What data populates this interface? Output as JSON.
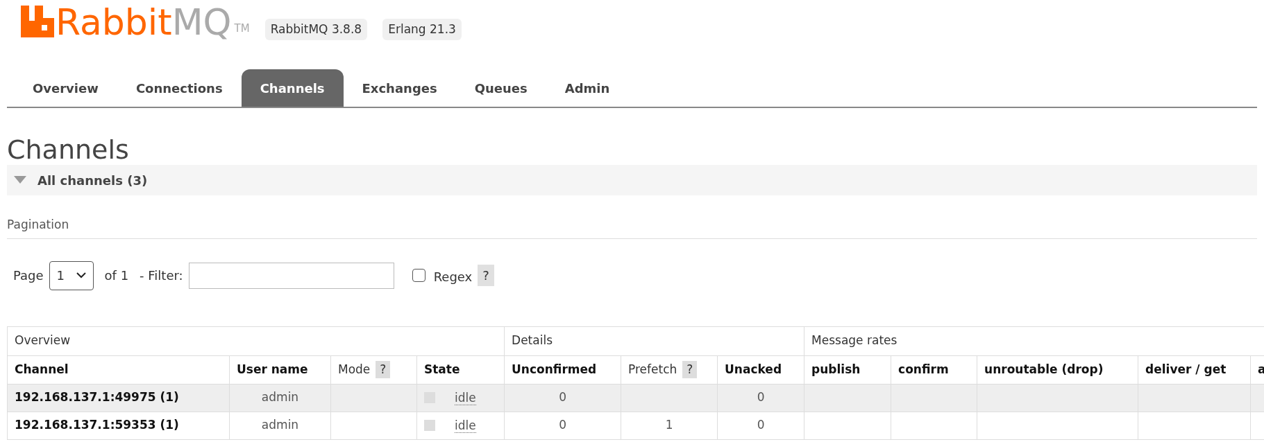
{
  "logo": {
    "brand_part": "Rabbit",
    "product_part": "MQ",
    "trademark": "TM"
  },
  "versions": [
    "RabbitMQ 3.8.8",
    "Erlang 21.3"
  ],
  "tabs": [
    {
      "label": "Overview",
      "selected": false
    },
    {
      "label": "Connections",
      "selected": false
    },
    {
      "label": "Channels",
      "selected": true
    },
    {
      "label": "Exchanges",
      "selected": false
    },
    {
      "label": "Queues",
      "selected": false
    },
    {
      "label": "Admin",
      "selected": false
    }
  ],
  "page_title": "Channels",
  "section": {
    "title": "All channels (3)",
    "expanded": true
  },
  "pagination": {
    "title": "Pagination",
    "page_label": "Page",
    "page_value": "1",
    "of_label": "of 1",
    "filter_label": "- Filter:",
    "regex_label": "Regex",
    "regex_checked": false,
    "help": "?"
  },
  "table": {
    "groups": [
      "Overview",
      "Details",
      "Message rates"
    ],
    "columns": [
      {
        "label": "Channel",
        "kind": "bold"
      },
      {
        "label": "User name",
        "kind": "bold"
      },
      {
        "label": "Mode",
        "kind": "plain",
        "help": "?"
      },
      {
        "label": "State",
        "kind": "bold"
      },
      {
        "label": "Unconfirmed",
        "kind": "bold"
      },
      {
        "label": "Prefetch",
        "kind": "plain",
        "help": "?"
      },
      {
        "label": "Unacked",
        "kind": "bold"
      },
      {
        "label": "publish",
        "kind": "bold"
      },
      {
        "label": "confirm",
        "kind": "bold"
      },
      {
        "label": "unroutable (drop)",
        "kind": "bold"
      },
      {
        "label": "deliver / get",
        "kind": "bold"
      },
      {
        "label": "a",
        "kind": "bold"
      }
    ],
    "rows": [
      {
        "channel": "192.168.137.1:49975 (1)",
        "user": "admin",
        "state": "idle",
        "unconfirmed": "0",
        "unacked": "0"
      },
      {
        "channel": "192.168.137.1:59353 (1)",
        "user": "admin",
        "state": "idle",
        "unconfirmed": "0",
        "prefetch": "1",
        "unacked": "0"
      }
    ]
  }
}
